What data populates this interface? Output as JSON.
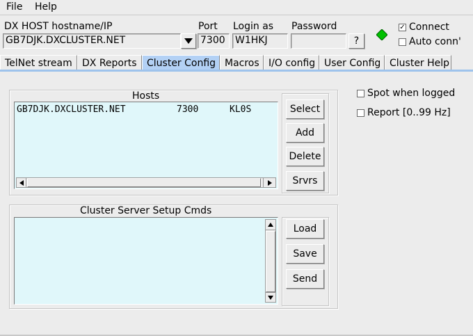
{
  "menu": {
    "file": "File",
    "help": "Help"
  },
  "connection": {
    "host_label": "DX HOST hostname/IP",
    "host_value": "GB7DJK.DXCLUSTER.NET",
    "port_label": "Port",
    "port_value": "7300",
    "login_label": "Login as",
    "login_value": "W1HKJ",
    "password_label": "Password",
    "password_value": "",
    "help_button": "?",
    "status_color": "#00c000",
    "connect_label": "Connect",
    "connect_checked": "✓",
    "autoconn_label": "Auto conn'"
  },
  "tabs": [
    "TelNet stream",
    "DX Reports",
    "Cluster Config",
    "Macros",
    "I/O config",
    "User Config",
    "Cluster Help"
  ],
  "active_tab": "Cluster Config",
  "hosts": {
    "title": "Hosts",
    "rows": [
      {
        "host": "GB7DJK.DXCLUSTER.NET",
        "port": "7300",
        "login": "KL0S"
      }
    ],
    "buttons": {
      "select": "Select",
      "add": "Add",
      "delete": "Delete",
      "srvrs": "Srvrs"
    }
  },
  "setup": {
    "title": "Cluster Server Setup Cmds",
    "buttons": {
      "load": "Load",
      "save": "Save",
      "send": "Send"
    }
  },
  "options": {
    "spot_when_logged": "Spot when logged",
    "report_hz": "Report [0..99 Hz]"
  }
}
